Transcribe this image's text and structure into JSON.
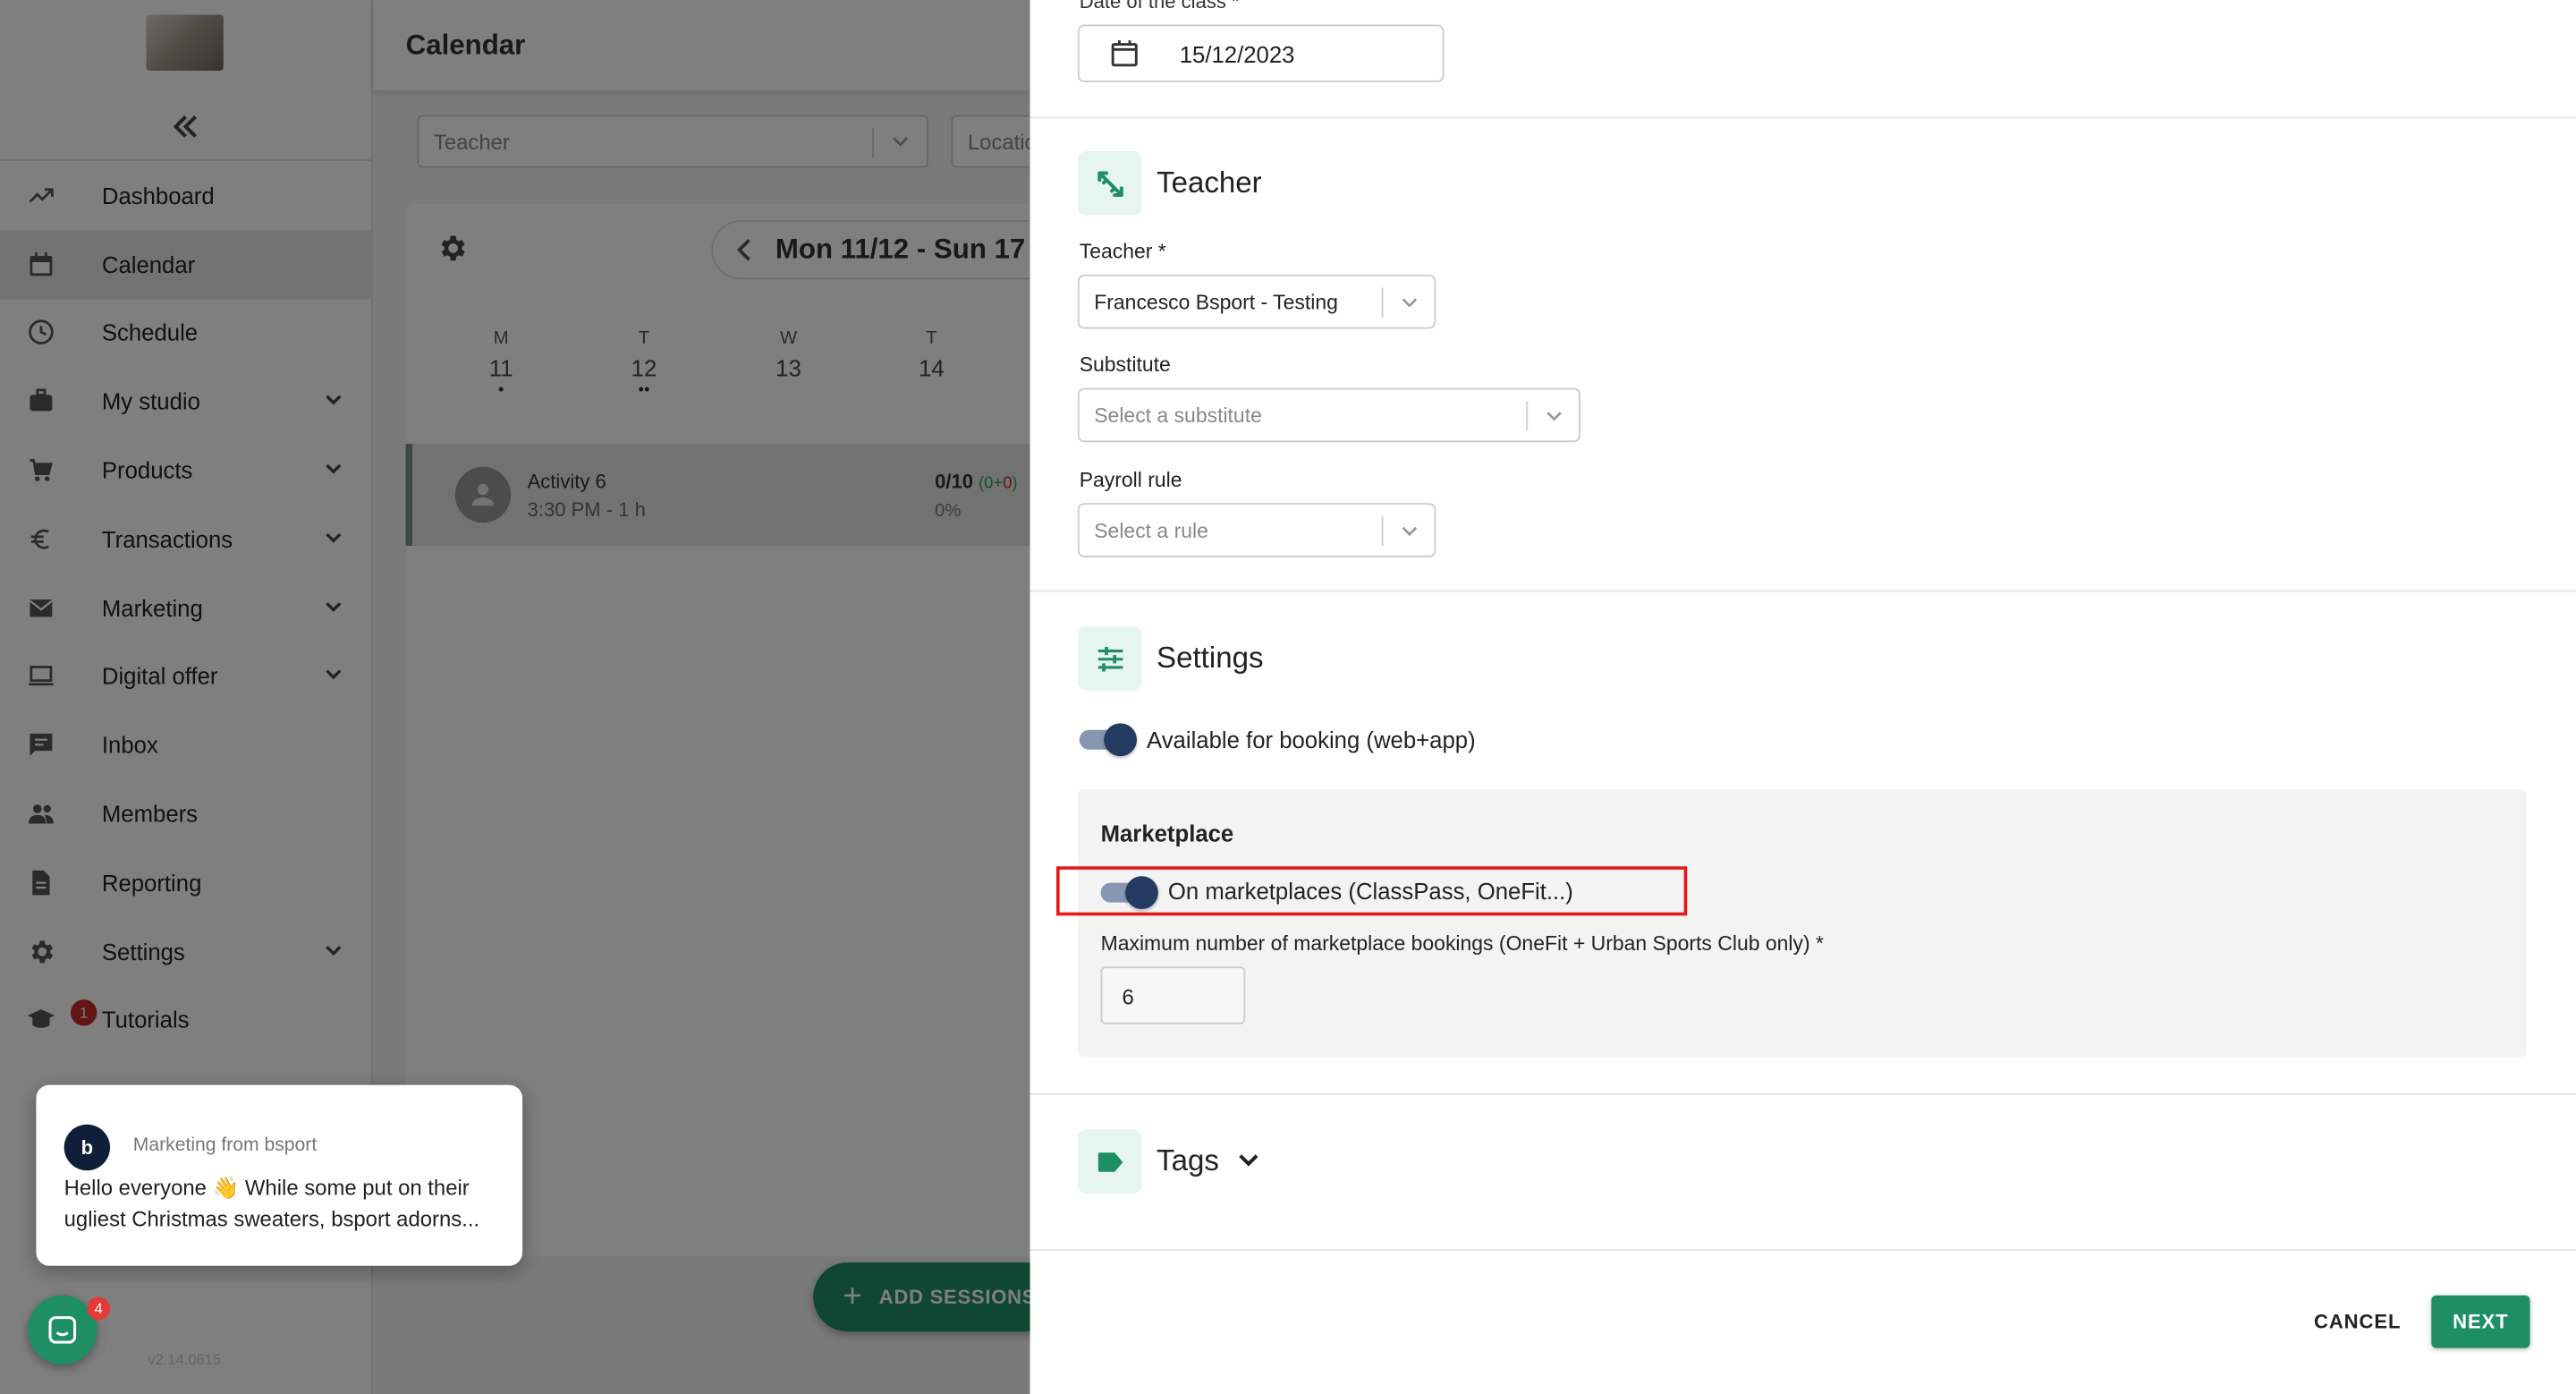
{
  "sidebar": {
    "items": [
      {
        "label": "Dashboard",
        "icon": "trending-up-icon",
        "active": false,
        "expandable": false
      },
      {
        "label": "Calendar",
        "icon": "calendar-icon",
        "active": true,
        "expandable": false
      },
      {
        "label": "Schedule",
        "icon": "clock-icon",
        "active": false,
        "expandable": false
      },
      {
        "label": "My studio",
        "icon": "briefcase-icon",
        "active": false,
        "expandable": true
      },
      {
        "label": "Products",
        "icon": "cart-icon",
        "active": false,
        "expandable": true
      },
      {
        "label": "Transactions",
        "icon": "euro-icon",
        "active": false,
        "expandable": true
      },
      {
        "label": "Marketing",
        "icon": "mail-icon",
        "active": false,
        "expandable": true
      },
      {
        "label": "Digital offer",
        "icon": "laptop-icon",
        "active": false,
        "expandable": true
      },
      {
        "label": "Inbox",
        "icon": "chat-icon",
        "active": false,
        "expandable": false
      },
      {
        "label": "Members",
        "icon": "people-icon",
        "active": false,
        "expandable": false
      },
      {
        "label": "Reporting",
        "icon": "document-icon",
        "active": false,
        "expandable": false
      },
      {
        "label": "Settings",
        "icon": "gear-icon",
        "active": false,
        "expandable": true
      },
      {
        "label": "Tutorials",
        "icon": "school-icon",
        "active": false,
        "expandable": false,
        "badge": "1"
      }
    ],
    "version": "v2.14.0615"
  },
  "calendar": {
    "title": "Calendar",
    "filter_teacher": "Teacher",
    "filter_location": "Locatio",
    "week_label": "Mon 11/12 - Sun 17",
    "days": [
      {
        "letter": "M",
        "num": "11",
        "dots": "•"
      },
      {
        "letter": "T",
        "num": "12",
        "dots": "••"
      },
      {
        "letter": "W",
        "num": "13",
        "dots": ""
      },
      {
        "letter": "T",
        "num": "14",
        "dots": ""
      }
    ],
    "activity": {
      "name": "Activity 6",
      "time": "3:30 PM - 1 h",
      "count": "0/10",
      "extra_open": "(",
      "extra_g": "0",
      "extra_plus": "+",
      "extra_r": "0",
      "extra_close": ")",
      "pct": "0%"
    },
    "add_sessions": "ADD SESSIONS"
  },
  "popup": {
    "logo": "b",
    "from": "Marketing from bsport",
    "message": "Hello everyone 👋 While some put on their ugliest Christmas sweaters, bsport adorns..."
  },
  "chat": {
    "badge": "4"
  },
  "drawer": {
    "date_label": "Date of the class *",
    "date_value": "15/12/2023",
    "teacher_section": "Teacher",
    "teacher_label": "Teacher *",
    "teacher_value": "Francesco Bsport - Testing",
    "substitute_label": "Substitute",
    "substitute_placeholder": "Select a substitute",
    "payroll_label": "Payroll rule",
    "payroll_placeholder": "Select a rule",
    "settings_section": "Settings",
    "booking_toggle": "Available for booking (web+app)",
    "marketplace_title": "Marketplace",
    "marketplace_toggle": "On marketplaces (ClassPass, OneFit...)",
    "max_label": "Maximum number of marketplace bookings (OneFit + Urban Sports Club only) *",
    "max_value": "6",
    "tags_section": "Tags",
    "cancel": "CANCEL",
    "next": "NEXT"
  },
  "colors": {
    "accent": "#1e8e63",
    "highlight": "#e21b1b",
    "toggle_on": "#243a60"
  }
}
